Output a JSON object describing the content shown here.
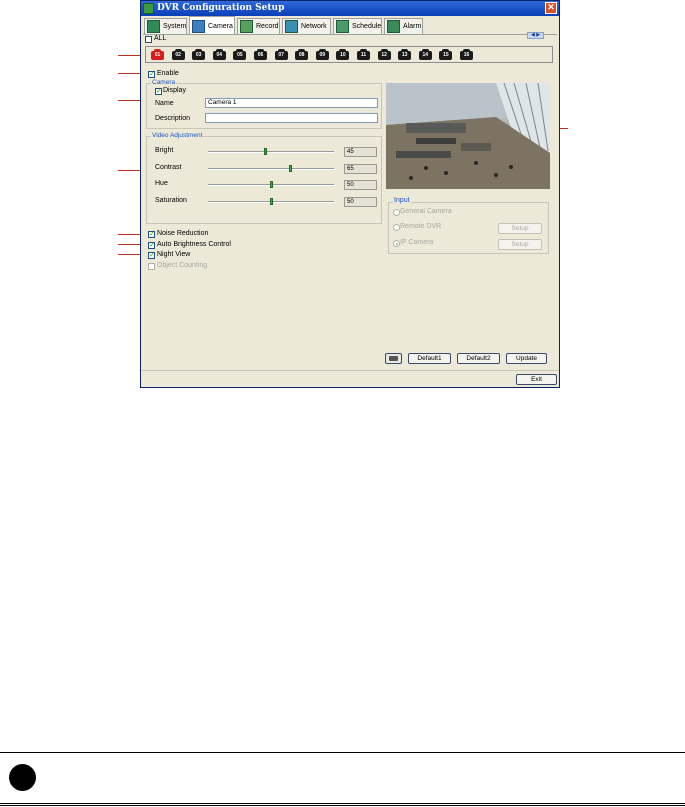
{
  "window": {
    "title": "DVR Configuration Setup",
    "close_symbol": "✕"
  },
  "tabs": [
    {
      "label": "System",
      "icon": "system-icon"
    },
    {
      "label": "Camera",
      "icon": "camera-icon",
      "active": true
    },
    {
      "label": "Record",
      "icon": "record-icon"
    },
    {
      "label": "Network",
      "icon": "network-icon"
    },
    {
      "label": "Schedule",
      "icon": "schedule-icon"
    },
    {
      "label": "Alarm",
      "icon": "alarm-icon"
    }
  ],
  "all_label": "ALL",
  "nav_arrows": "◀ ▶",
  "cameras": [
    "01",
    "02",
    "03",
    "04",
    "05",
    "06",
    "07",
    "08",
    "09",
    "10",
    "11",
    "12",
    "13",
    "14",
    "15",
    "16"
  ],
  "selected_camera": "01",
  "enable": {
    "label": "Enable",
    "checked": true
  },
  "camera_group": {
    "title": "Camera",
    "display_label": "Display",
    "name_label": "Name",
    "name_value": "Camera 1",
    "description_label": "Description",
    "description_value": ""
  },
  "video_adjustment": {
    "title": "Video Adjustment",
    "items": [
      {
        "label": "Bright",
        "value": "45",
        "level": 0.45
      },
      {
        "label": "Contrast",
        "value": "65",
        "level": 0.65
      },
      {
        "label": "Hue",
        "value": "50",
        "level": 0.5
      },
      {
        "label": "Saturation",
        "value": "50",
        "level": 0.5
      }
    ]
  },
  "options": [
    {
      "label": "Noise Reduction",
      "checked": true,
      "enabled": true
    },
    {
      "label": "Auto Brightness Control",
      "checked": true,
      "enabled": true
    },
    {
      "label": "Night View",
      "checked": true,
      "enabled": true
    },
    {
      "label": "Object Counting",
      "checked": false,
      "enabled": false
    }
  ],
  "input_group": {
    "title": "Input",
    "options": [
      {
        "label": "General Camera",
        "selected": false
      },
      {
        "label": "Remote DVR",
        "selected": false,
        "button": "Setup"
      },
      {
        "label": "IP Camera",
        "selected": true,
        "button": "Setup"
      }
    ]
  },
  "buttons": {
    "default1": "Default1",
    "default2": "Default2",
    "update": "Update",
    "exit": "Exit"
  },
  "colors": {
    "title_bar": "#0a3fb8",
    "window_bg": "#ece9d8",
    "group_title": "#1a54c2",
    "callout_line": "#c0301a",
    "selected_camera": "#d81b1b"
  }
}
